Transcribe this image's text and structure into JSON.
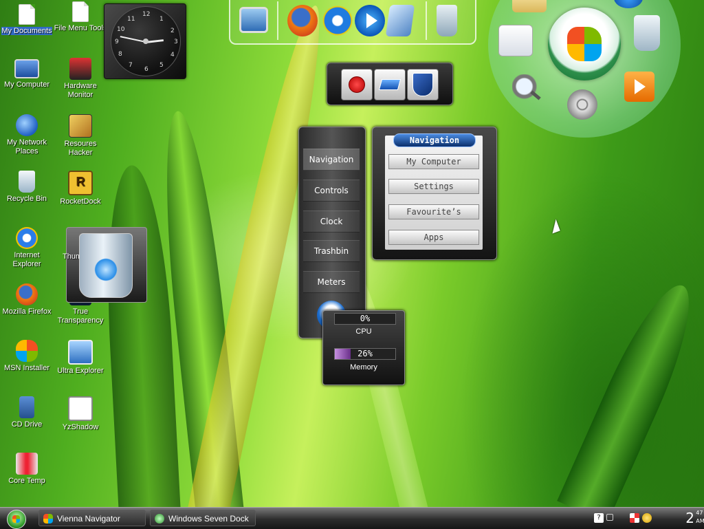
{
  "desktop": {
    "icons_left": [
      {
        "label": "My Documents",
        "icon": "documents-icon",
        "selected": true
      },
      {
        "label": "My Computer",
        "icon": "computer-icon"
      },
      {
        "label": "My Network Places",
        "icon": "network-icon"
      },
      {
        "label": "Recycle Bin",
        "icon": "recycle-bin-icon"
      },
      {
        "label": "Internet Explorer",
        "icon": "internet-explorer-icon"
      },
      {
        "label": "Mozilla Firefox",
        "icon": "firefox-icon"
      },
      {
        "label": "MSN Installer",
        "icon": "msn-icon"
      },
      {
        "label": "CD Drive",
        "icon": "cd-drive-icon"
      },
      {
        "label": "Core Temp",
        "icon": "thermometer-icon"
      }
    ],
    "icons_right": [
      {
        "label": "File Menu Tools",
        "icon": "file-menu-icon"
      },
      {
        "label": "Hardware Monitor",
        "icon": "hardware-monitor-icon"
      },
      {
        "label": "Resoures Hacker",
        "icon": "resource-hacker-icon"
      },
      {
        "label": "RocketDock",
        "icon": "rocketdock-icon"
      },
      {
        "label": "True Transparency",
        "icon": "transparency-icon"
      },
      {
        "label": "Ultra Explorer",
        "icon": "ultra-explorer-icon"
      },
      {
        "label": "YzShadow",
        "icon": "yzshadow-icon"
      }
    ],
    "hidden_label": "Thum",
    "rocketdock_glyph": "R"
  },
  "clock_widget": {
    "numbers": [
      "12",
      "1",
      "2",
      "3",
      "4",
      "5",
      "6",
      "7",
      "8",
      "9",
      "10",
      "11"
    ],
    "hour": 2,
    "minute": 47
  },
  "quick_launch": [
    "monitor-icon",
    "firefox-icon",
    "internet-explorer-icon",
    "media-player-icon",
    "system-properties-icon",
    "trash-icon"
  ],
  "power_widget": [
    "shutdown-icon",
    "restart-icon",
    "logoff-shield-icon"
  ],
  "orb_menu": [
    "folder-icon",
    "globe-icon",
    "notes-icon",
    "windows-orb-icon",
    "recycle-bin-icon",
    "search-magnifier-icon",
    "film-reel-icon",
    "media-player-icon"
  ],
  "vienna_nav": {
    "items": [
      "Navigation",
      "Controls",
      "Clock",
      "Trashbin",
      "Meters"
    ],
    "active": "Navigation"
  },
  "nav_popup": {
    "title": "Navigation",
    "items": [
      "My Computer",
      "Settings",
      "Favourite’s",
      "Apps"
    ]
  },
  "meters": {
    "cpu": {
      "value": "0%",
      "fraction": 0.0,
      "label": "CPU"
    },
    "memory": {
      "value": "26%",
      "fraction": 0.26,
      "label": "Memory"
    }
  },
  "taskbar": {
    "tasks": [
      {
        "label": "Vienna Navigator",
        "icon": "windows-flag-icon"
      },
      {
        "label": "Windows Seven Dock",
        "icon": "dock-icon"
      }
    ],
    "clock_hour": "2",
    "clock_minute": "47",
    "clock_ampm": "AM"
  },
  "colors": {
    "accent_blue": "#316ac5",
    "meter_fill": "#c58fe0",
    "shutdown_red": "#d80000"
  }
}
